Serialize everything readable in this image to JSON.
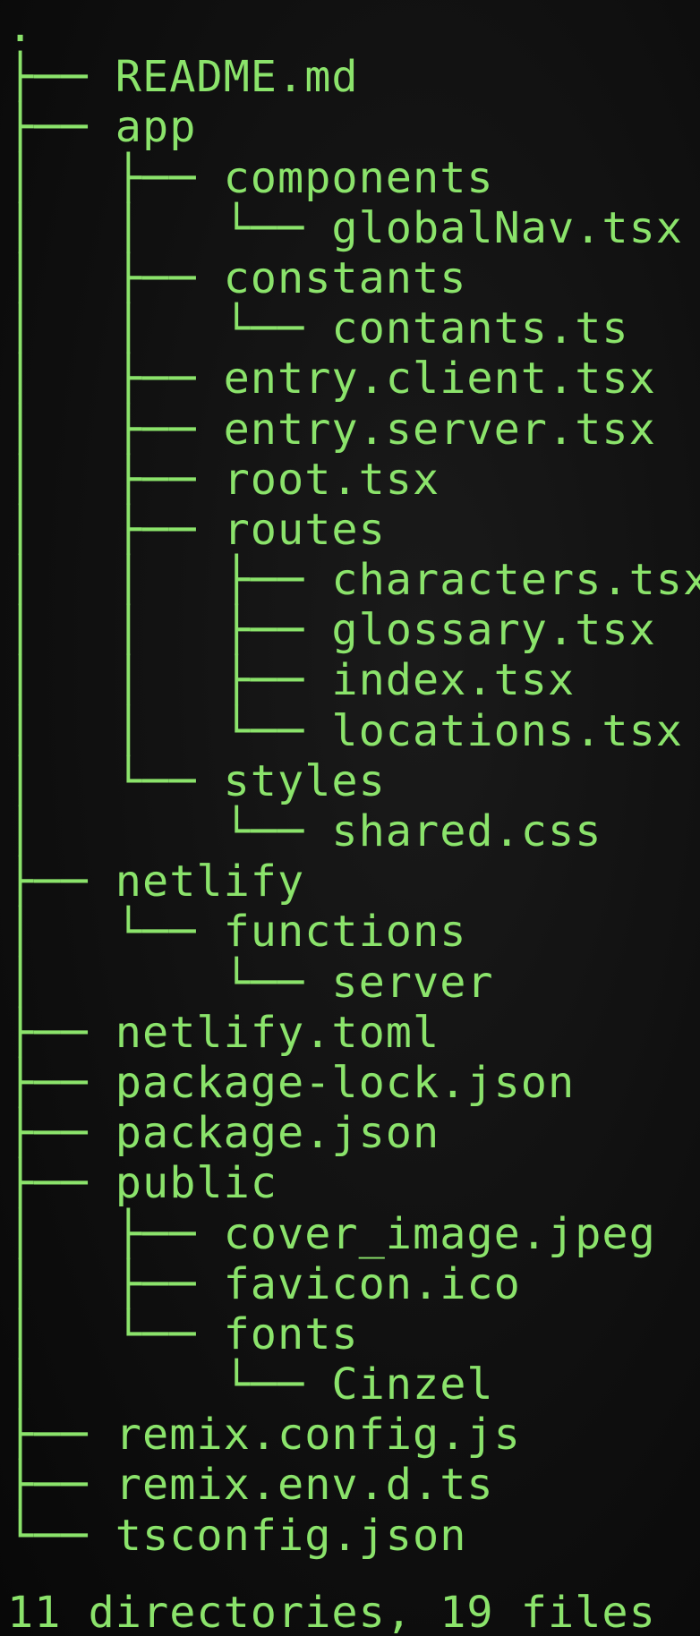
{
  "terminal": {
    "tree_lines": [
      ".",
      "├── README.md",
      "├── app",
      "│   ├── components",
      "│   │   └── globalNav.tsx",
      "│   ├── constants",
      "│   │   └── contants.ts",
      "│   ├── entry.client.tsx",
      "│   ├── entry.server.tsx",
      "│   ├── root.tsx",
      "│   ├── routes",
      "│   │   ├── characters.tsx",
      "│   │   ├── glossary.tsx",
      "│   │   ├── index.tsx",
      "│   │   └── locations.tsx",
      "│   └── styles",
      "│       └── shared.css",
      "├── netlify",
      "│   └── functions",
      "│       └── server",
      "├── netlify.toml",
      "├── package-lock.json",
      "├── package.json",
      "├── public",
      "│   ├── cover_image.jpeg",
      "│   ├── favicon.ico",
      "│   └── fonts",
      "│       └── Cinzel",
      "├── remix.config.js",
      "├── remix.env.d.ts",
      "└── tsconfig.json"
    ],
    "summary": "11 directories, 19 files",
    "text_color": "#8be36b",
    "background_color": "#0d0d0d"
  }
}
